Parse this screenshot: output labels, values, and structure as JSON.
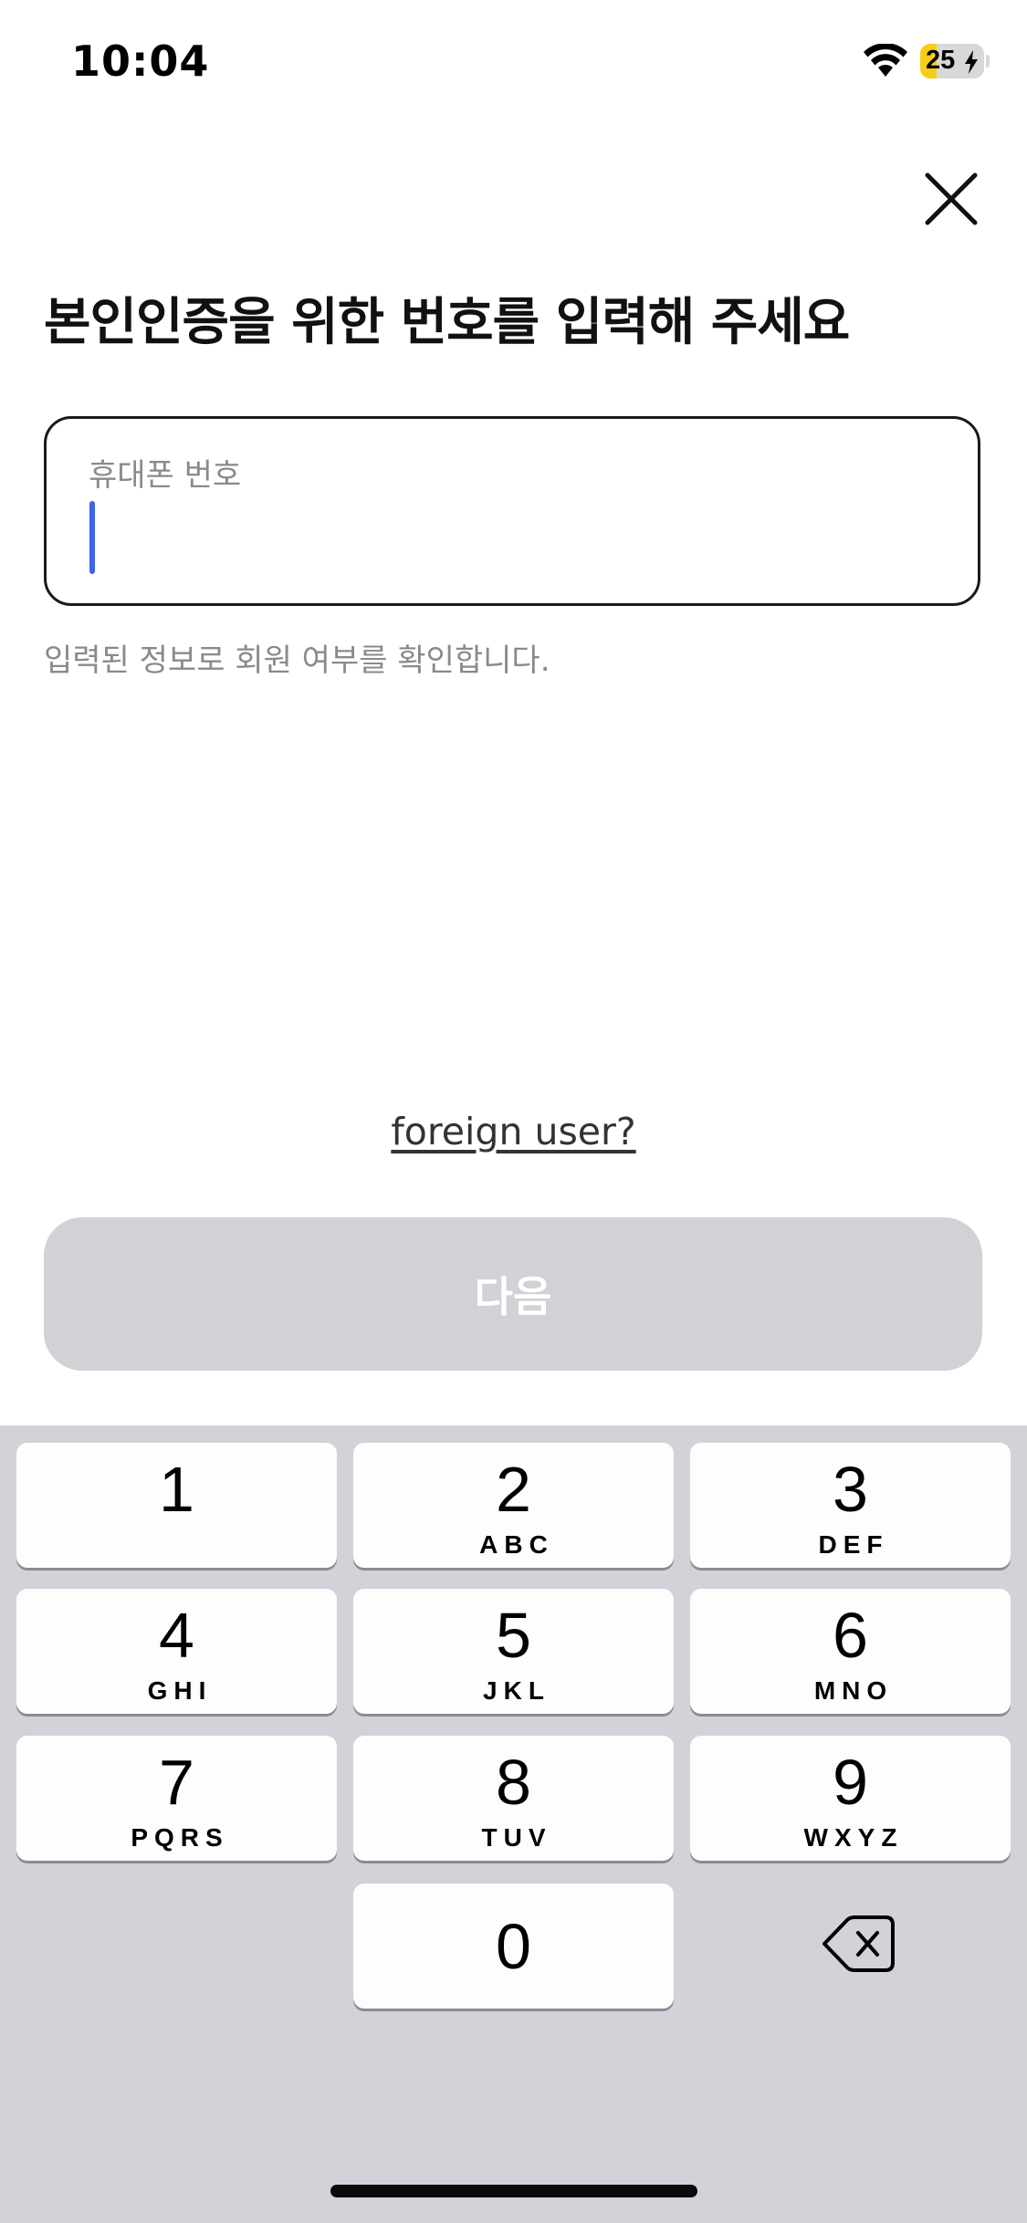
{
  "status_bar": {
    "time": "10:04",
    "battery_level": "25",
    "battery_fraction": 0.25,
    "battery_color": "#f6cd17"
  },
  "header": {
    "close_icon": "close-icon"
  },
  "title": "본인인증을 위한 번호를 입력해 주세요",
  "phone_field": {
    "label": "휴대폰 번호",
    "value": ""
  },
  "helper_text": "입력된 정보로 회원 여부를 확인합니다.",
  "foreign_link": "foreign user?",
  "next_button": {
    "label": "다음",
    "color": "#d1d1d6"
  },
  "keypad": {
    "keys": [
      {
        "digit": "1",
        "letters": ""
      },
      {
        "digit": "2",
        "letters": "ABC"
      },
      {
        "digit": "3",
        "letters": "DEF"
      },
      {
        "digit": "4",
        "letters": "GHI"
      },
      {
        "digit": "5",
        "letters": "JKL"
      },
      {
        "digit": "6",
        "letters": "MNO"
      },
      {
        "digit": "7",
        "letters": "PQRS"
      },
      {
        "digit": "8",
        "letters": "TUV"
      },
      {
        "digit": "9",
        "letters": "WXYZ"
      },
      {
        "digit": "0",
        "letters": ""
      }
    ],
    "backspace_icon": "backspace-icon"
  }
}
